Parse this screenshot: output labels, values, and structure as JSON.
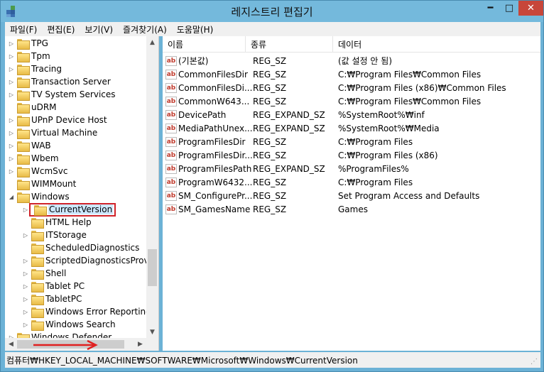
{
  "window": {
    "title": "레지스트리 편집기",
    "minimize_symbol": "━",
    "maximize_symbol": "□",
    "close_symbol": "✕"
  },
  "menu": [
    "파일(F)",
    "편집(E)",
    "보기(V)",
    "즐겨찾기(A)",
    "도움말(H)"
  ],
  "tree": {
    "items": [
      {
        "label": "TPG",
        "expander": "▷",
        "indent": 0
      },
      {
        "label": "Tpm",
        "expander": "▷",
        "indent": 0
      },
      {
        "label": "Tracing",
        "expander": "▷",
        "indent": 0
      },
      {
        "label": "Transaction Server",
        "expander": "▷",
        "indent": 0
      },
      {
        "label": "TV System Services",
        "expander": "▷",
        "indent": 0
      },
      {
        "label": "uDRM",
        "expander": "",
        "indent": 0
      },
      {
        "label": "UPnP Device Host",
        "expander": "▷",
        "indent": 0
      },
      {
        "label": "Virtual Machine",
        "expander": "▷",
        "indent": 0
      },
      {
        "label": "WAB",
        "expander": "▷",
        "indent": 0
      },
      {
        "label": "Wbem",
        "expander": "▷",
        "indent": 0
      },
      {
        "label": "WcmSvc",
        "expander": "▷",
        "indent": 0
      },
      {
        "label": "WIMMount",
        "expander": "",
        "indent": 0
      },
      {
        "label": "Windows",
        "expander": "◢",
        "indent": 0
      },
      {
        "label": "CurrentVersion",
        "expander": "▷",
        "indent": 1,
        "selected": true
      },
      {
        "label": "HTML Help",
        "expander": "",
        "indent": 1
      },
      {
        "label": "ITStorage",
        "expander": "▷",
        "indent": 1
      },
      {
        "label": "ScheduledDiagnostics",
        "expander": "",
        "indent": 1
      },
      {
        "label": "ScriptedDiagnosticsProvic",
        "expander": "▷",
        "indent": 1
      },
      {
        "label": "Shell",
        "expander": "▷",
        "indent": 1
      },
      {
        "label": "Tablet PC",
        "expander": "▷",
        "indent": 1
      },
      {
        "label": "TabletPC",
        "expander": "▷",
        "indent": 1
      },
      {
        "label": "Windows Error Reporting",
        "expander": "▷",
        "indent": 1
      },
      {
        "label": "Windows Search",
        "expander": "▷",
        "indent": 1
      },
      {
        "label": "Windows Defender",
        "expander": "▷",
        "indent": 0
      }
    ]
  },
  "list": {
    "columns": [
      "이름",
      "종류",
      "데이터"
    ],
    "rows": [
      {
        "name": "(기본값)",
        "type": "REG_SZ",
        "data": "(값 설정 안 됨)"
      },
      {
        "name": "CommonFilesDir",
        "type": "REG_SZ",
        "data": "C:₩Program Files₩Common Files"
      },
      {
        "name": "CommonFilesDi...",
        "type": "REG_SZ",
        "data": "C:₩Program Files (x86)₩Common Files"
      },
      {
        "name": "CommonW643...",
        "type": "REG_SZ",
        "data": "C:₩Program Files₩Common Files"
      },
      {
        "name": "DevicePath",
        "type": "REG_EXPAND_SZ",
        "data": "%SystemRoot%₩inf"
      },
      {
        "name": "MediaPathUnex...",
        "type": "REG_EXPAND_SZ",
        "data": "%SystemRoot%₩Media"
      },
      {
        "name": "ProgramFilesDir",
        "type": "REG_SZ",
        "data": "C:₩Program Files"
      },
      {
        "name": "ProgramFilesDir...",
        "type": "REG_SZ",
        "data": "C:₩Program Files (x86)"
      },
      {
        "name": "ProgramFilesPath",
        "type": "REG_EXPAND_SZ",
        "data": "%ProgramFiles%"
      },
      {
        "name": "ProgramW6432...",
        "type": "REG_SZ",
        "data": "C:₩Program Files"
      },
      {
        "name": "SM_ConfigurePr...",
        "type": "REG_SZ",
        "data": "Set Program Access and Defaults"
      },
      {
        "name": "SM_GamesName",
        "type": "REG_SZ",
        "data": "Games"
      }
    ],
    "icon_text": "ab"
  },
  "status": {
    "path": "컴퓨터₩HKEY_LOCAL_MACHINE₩SOFTWARE₩Microsoft₩Windows₩CurrentVersion"
  },
  "colors": {
    "frame": "#74b9dc",
    "close": "#c7463a",
    "highlight_box": "#d0232a",
    "red_arrow": "#e02020"
  }
}
